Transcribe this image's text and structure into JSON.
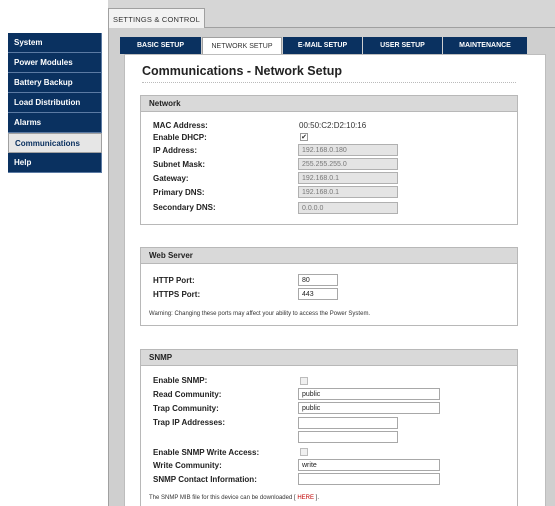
{
  "top_tab": "SETTINGS & CONTROL",
  "sidebar": {
    "items": [
      {
        "label": "System"
      },
      {
        "label": "Power Modules"
      },
      {
        "label": "Battery Backup"
      },
      {
        "label": "Load Distribution"
      },
      {
        "label": "Alarms"
      },
      {
        "label": "Communications",
        "active": true
      },
      {
        "label": "Help"
      }
    ]
  },
  "subtabs": [
    {
      "label": "BASIC SETUP"
    },
    {
      "label": "NETWORK SETUP",
      "active": true
    },
    {
      "label": "E-MAIL SETUP"
    },
    {
      "label": "USER SETUP"
    },
    {
      "label": "MAINTENANCE"
    }
  ],
  "page_title": "Communications - Network Setup",
  "network": {
    "title": "Network",
    "mac_label": "MAC Address:",
    "mac_value": "00:50:C2:D2:10:16",
    "dhcp_label": "Enable DHCP:",
    "dhcp_checked": "✔",
    "ip_label": "IP Address:",
    "ip_value": "192.168.0.180",
    "subnet_label": "Subnet Mask:",
    "subnet_value": "255.255.255.0",
    "gateway_label": "Gateway:",
    "gateway_value": "192.168.0.1",
    "pdns_label": "Primary DNS:",
    "pdns_value": "192.168.0.1",
    "sdns_label": "Secondary DNS:",
    "sdns_value": "0.0.0.0"
  },
  "webserver": {
    "title": "Web Server",
    "http_label": "HTTP Port:",
    "http_value": "80",
    "https_label": "HTTPS Port:",
    "https_value": "443",
    "warning": "Warning: Changing these ports may affect your ability to access the Power System."
  },
  "snmp": {
    "title": "SNMP",
    "enable_label": "Enable SNMP:",
    "read_label": "Read Community:",
    "read_value": "public",
    "trap_label": "Trap Community:",
    "trap_value": "public",
    "trapip_label": "Trap IP Addresses:",
    "write_access_label": "Enable SNMP Write Access:",
    "write_label": "Write Community:",
    "write_value": "write",
    "contact_label": "SNMP Contact Information:",
    "mib_note_pre": "The SNMP MIB file for this device can be downloaded [",
    "mib_link": "HERE",
    "mib_note_post": "]."
  }
}
